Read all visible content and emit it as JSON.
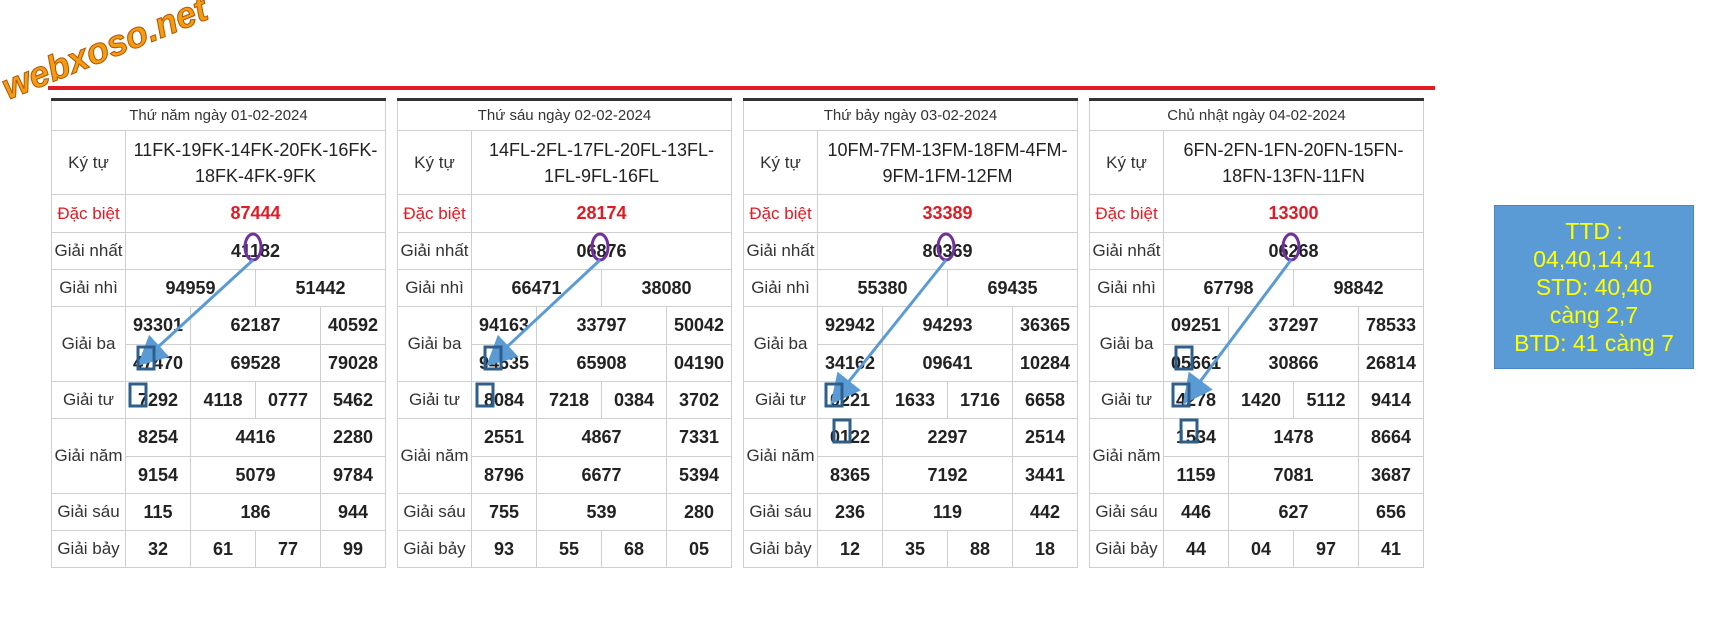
{
  "brand": {
    "logo_text": "webxoso.net",
    "accent_color": "#e01b24",
    "logo_color": "#f39c12"
  },
  "labels": {
    "kytu": "Ký tự",
    "db": "Đặc biệt",
    "g1": "Giải nhất",
    "g2": "Giải nhì",
    "g3": "Giải ba",
    "g4": "Giải tư",
    "g5": "Giải năm",
    "g6": "Giải sáu",
    "g7": "Giải bảy"
  },
  "days": [
    {
      "title": "Thứ năm ngày 01-02-2024",
      "kytu": "11FK-19FK-14FK-20FK-16FK-18FK-4FK-9FK",
      "db": "87444",
      "g1": "41182",
      "g2": [
        "94959",
        "51442"
      ],
      "g3": [
        [
          "93301",
          "62187",
          "40592"
        ],
        [
          "47470",
          "69528",
          "79028"
        ]
      ],
      "g4": [
        "7292",
        "4118",
        "0777",
        "5462"
      ],
      "g5": [
        [
          "8254",
          "4416",
          "2280"
        ],
        [
          "9154",
          "5079",
          "9784"
        ]
      ],
      "g6": [
        "115",
        "186",
        "944"
      ],
      "g7": [
        "32",
        "61",
        "77",
        "99"
      ]
    },
    {
      "title": "Thứ sáu ngày 02-02-2024",
      "kytu": "14FL-2FL-17FL-20FL-13FL-1FL-9FL-16FL",
      "db": "28174",
      "g1": "06876",
      "g2": [
        "66471",
        "38080"
      ],
      "g3": [
        [
          "94163",
          "33797",
          "50042"
        ],
        [
          "94635",
          "65908",
          "04190"
        ]
      ],
      "g4": [
        "8084",
        "7218",
        "0384",
        "3702"
      ],
      "g5": [
        [
          "2551",
          "4867",
          "7331"
        ],
        [
          "8796",
          "6677",
          "5394"
        ]
      ],
      "g6": [
        "755",
        "539",
        "280"
      ],
      "g7": [
        "93",
        "55",
        "68",
        "05"
      ]
    },
    {
      "title": "Thứ bảy ngày 03-02-2024",
      "kytu": "10FM-7FM-13FM-18FM-4FM-9FM-1FM-12FM",
      "db": "33389",
      "g1": "80369",
      "g2": [
        "55380",
        "69435"
      ],
      "g3": [
        [
          "92942",
          "94293",
          "36365"
        ],
        [
          "34162",
          "09641",
          "10284"
        ]
      ],
      "g4": [
        "0221",
        "1633",
        "1716",
        "6658"
      ],
      "g5": [
        [
          "0122",
          "2297",
          "2514"
        ],
        [
          "8365",
          "7192",
          "3441"
        ]
      ],
      "g6": [
        "236",
        "119",
        "442"
      ],
      "g7": [
        "12",
        "35",
        "88",
        "18"
      ]
    },
    {
      "title": "Chủ nhật ngày 04-02-2024",
      "kytu": "6FN-2FN-1FN-20FN-15FN-18FN-13FN-11FN",
      "db": "13300",
      "g1": "06268",
      "g2": [
        "67798",
        "98842"
      ],
      "g3": [
        [
          "09251",
          "37297",
          "78533"
        ],
        [
          "05661",
          "30866",
          "26814"
        ]
      ],
      "g4": [
        "4278",
        "1420",
        "5112",
        "9414"
      ],
      "g5": [
        [
          "1534",
          "1478",
          "8664"
        ],
        [
          "1159",
          "7081",
          "3687"
        ]
      ],
      "g6": [
        "446",
        "627",
        "656"
      ],
      "g7": [
        "44",
        "04",
        "97",
        "41"
      ]
    }
  ],
  "summary": {
    "line1": "TTD :",
    "line2": "04,40,14,41",
    "line3": "STD: 40,40",
    "line4": "càng 2,7",
    "line5": "BTD: 41 càng 7",
    "bg_color": "#5b9bd5",
    "text_color": "#ffff00"
  },
  "annotations": {
    "circle_color": "#7030a0",
    "box_color": "#2e5f8a",
    "arrow_color": "#5b9bd5"
  }
}
